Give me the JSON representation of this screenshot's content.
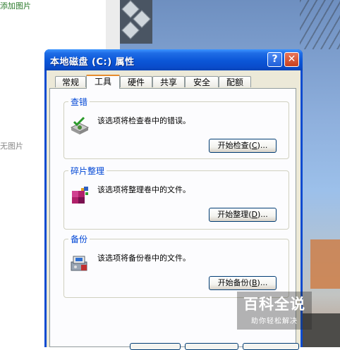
{
  "page": {
    "add_image": "添加图片",
    "no_image": "无图片"
  },
  "dialog": {
    "title": "本地磁盘 (C:) 属性",
    "help_label": "?",
    "close_label": "✕",
    "tabs": [
      {
        "label": "常规",
        "active": false
      },
      {
        "label": "工具",
        "active": true
      },
      {
        "label": "硬件",
        "active": false
      },
      {
        "label": "共享",
        "active": false
      },
      {
        "label": "安全",
        "active": false
      },
      {
        "label": "配额",
        "active": false
      }
    ],
    "groups": {
      "error_check": {
        "label": "查错",
        "description": "该选项将检查卷中的错误。",
        "button_text": "开始检查",
        "button_key": "C",
        "icon": "check-disk-icon"
      },
      "defrag": {
        "label": "碎片整理",
        "description": "该选项将整理卷中的文件。",
        "button_text": "开始整理",
        "button_key": "D",
        "icon": "defrag-icon"
      },
      "backup": {
        "label": "备份",
        "description": "该选项将备份卷中的文件。",
        "button_text": "开始备份",
        "button_key": "B",
        "icon": "backup-icon"
      }
    }
  },
  "watermark": {
    "title": "百科全说",
    "subtitle": "助你轻松解决"
  },
  "colors": {
    "title_bar": "#0a4bd0",
    "panel_bg": "#fcfcfe",
    "group_label": "#0046d5",
    "active_tab_accent": "#e68b2c"
  }
}
